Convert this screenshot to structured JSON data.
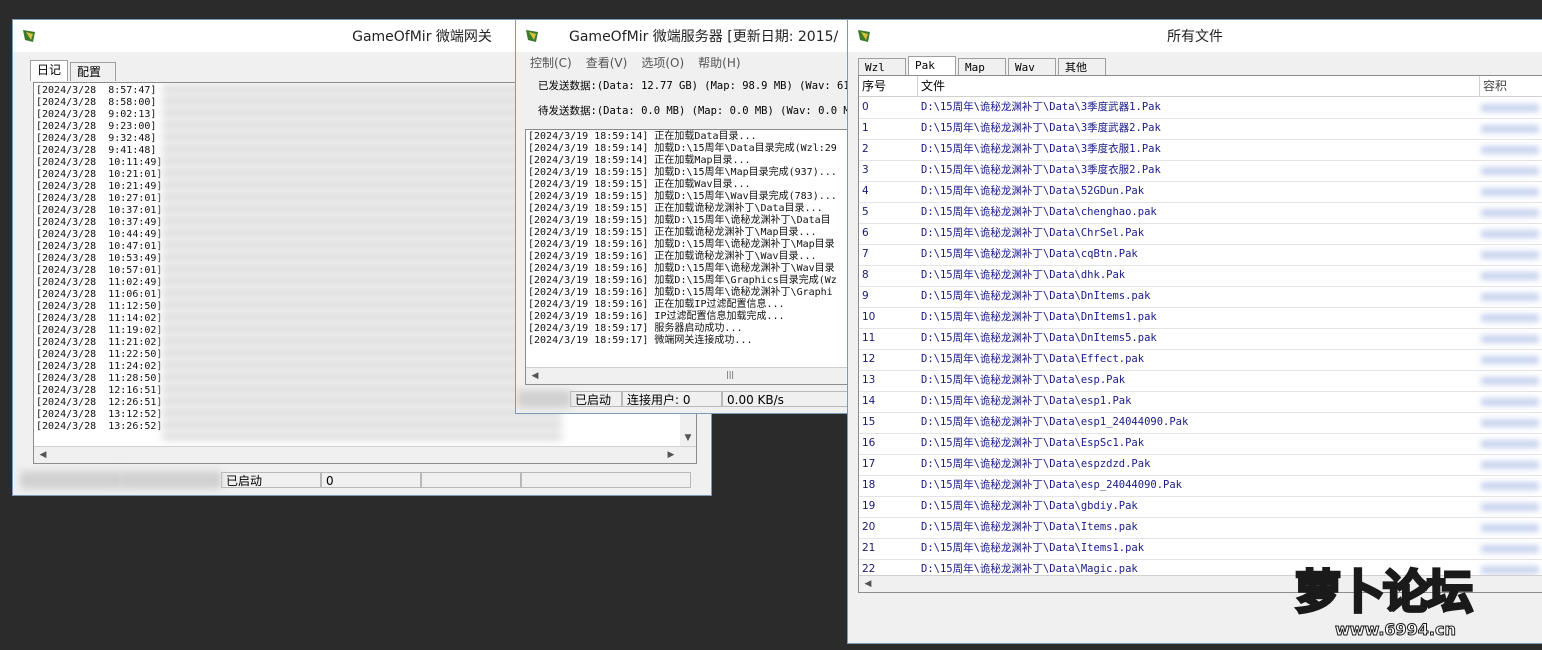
{
  "gateway": {
    "title": "GameOfMir 微端网关",
    "tabs": [
      "日记",
      "配置"
    ],
    "log_times": [
      "[2024/3/28  8:57:47]",
      "[2024/3/28  8:58:00]",
      "[2024/3/28  9:02:13]",
      "[2024/3/28  9:23:00]",
      "[2024/3/28  9:32:48]",
      "[2024/3/28  9:41:48]",
      "[2024/3/28  10:11:49]",
      "[2024/3/28  10:21:01]",
      "[2024/3/28  10:21:49]",
      "[2024/3/28  10:27:01]",
      "[2024/3/28  10:37:01]",
      "[2024/3/28  10:37:49]",
      "[2024/3/28  10:44:49]",
      "[2024/3/28  10:47:01]",
      "[2024/3/28  10:53:49]",
      "[2024/3/28  10:57:01]",
      "[2024/3/28  11:02:49]",
      "[2024/3/28  11:06:01]",
      "[2024/3/28  11:12:50]",
      "[2024/3/28  11:14:02]",
      "[2024/3/28  11:19:02]",
      "[2024/3/28  11:21:02]",
      "[2024/3/28  11:22:50]",
      "[2024/3/28  11:24:02]",
      "[2024/3/28  11:28:50]",
      "[2024/3/28  12:16:51]",
      "[2024/3/28  12:26:51]",
      "[2024/3/28  13:12:52]",
      "[2024/3/28  13:26:52]"
    ],
    "status": {
      "state": "已启动",
      "count": "0"
    }
  },
  "server": {
    "title": "GameOfMir 微端服务器 [更新日期: 2015/",
    "menu": [
      "控制(C)",
      "查看(V)",
      "选项(O)",
      "帮助(H)"
    ],
    "sent": "已发送数据:(Data: 12.77 GB) (Map: 98.9 MB) (Wav: 61",
    "pending": "待发送数据:(Data: 0.0 MB) (Map: 0.0 MB) (Wav: 0.0 M",
    "log": [
      "[2024/3/19 18:59:14] 正在加载Data目录...",
      "[2024/3/19 18:59:14] 加载D:\\15周年\\Data目录完成(Wzl:29",
      "[2024/3/19 18:59:14] 正在加载Map目录...",
      "[2024/3/19 18:59:15] 加载D:\\15周年\\Map目录完成(937)...",
      "[2024/3/19 18:59:15] 正在加载Wav目录...",
      "[2024/3/19 18:59:15] 加载D:\\15周年\\Wav目录完成(783)...",
      "[2024/3/19 18:59:15] 正在加载诡秘龙渊补丁\\Data目录...",
      "[2024/3/19 18:59:15] 加载D:\\15周年\\诡秘龙渊补丁\\Data目",
      "[2024/3/19 18:59:15] 正在加载诡秘龙渊补丁\\Map目录...",
      "[2024/3/19 18:59:16] 加载D:\\15周年\\诡秘龙渊补丁\\Map目录",
      "[2024/3/19 18:59:16] 正在加载诡秘龙渊补丁\\Wav目录...",
      "[2024/3/19 18:59:16] 加载D:\\15周年\\诡秘龙渊补丁\\Wav目录",
      "[2024/3/19 18:59:16] 加载D:\\15周年\\Graphics目录完成(Wz",
      "[2024/3/19 18:59:16] 加载D:\\15周年\\诡秘龙渊补丁\\Graphi",
      "[2024/3/19 18:59:16] 正在加载IP过滤配置信息...",
      "[2024/3/19 18:59:16] IP过滤配置信息加载完成...",
      "[2024/3/19 18:59:17] 服务器启动成功...",
      "[2024/3/19 18:59:17] 微端网关连接成功..."
    ],
    "status": {
      "state": "已启动",
      "users": "连接用户: 0",
      "speed": "0.00 KB/s"
    }
  },
  "files": {
    "title": "所有文件",
    "tabs": [
      "Wzl",
      "Pak",
      "Map",
      "Wav",
      "其他"
    ],
    "columns": {
      "index": "序号",
      "file": "文件",
      "size": "容积"
    },
    "rows": [
      {
        "i": "0",
        "path": "D:\\15周年\\诡秘龙渊补丁\\Data\\3季度武器1.Pak"
      },
      {
        "i": "1",
        "path": "D:\\15周年\\诡秘龙渊补丁\\Data\\3季度武器2.Pak"
      },
      {
        "i": "2",
        "path": "D:\\15周年\\诡秘龙渊补丁\\Data\\3季度衣服1.Pak"
      },
      {
        "i": "3",
        "path": "D:\\15周年\\诡秘龙渊补丁\\Data\\3季度衣服2.Pak"
      },
      {
        "i": "4",
        "path": "D:\\15周年\\诡秘龙渊补丁\\Data\\52GDun.Pak"
      },
      {
        "i": "5",
        "path": "D:\\15周年\\诡秘龙渊补丁\\Data\\chenghao.pak"
      },
      {
        "i": "6",
        "path": "D:\\15周年\\诡秘龙渊补丁\\Data\\ChrSel.Pak"
      },
      {
        "i": "7",
        "path": "D:\\15周年\\诡秘龙渊补丁\\Data\\cqBtn.Pak"
      },
      {
        "i": "8",
        "path": "D:\\15周年\\诡秘龙渊补丁\\Data\\dhk.Pak"
      },
      {
        "i": "9",
        "path": "D:\\15周年\\诡秘龙渊补丁\\Data\\DnItems.pak"
      },
      {
        "i": "10",
        "path": "D:\\15周年\\诡秘龙渊补丁\\Data\\DnItems1.pak"
      },
      {
        "i": "11",
        "path": "D:\\15周年\\诡秘龙渊补丁\\Data\\DnItems5.pak"
      },
      {
        "i": "12",
        "path": "D:\\15周年\\诡秘龙渊补丁\\Data\\Effect.pak"
      },
      {
        "i": "13",
        "path": "D:\\15周年\\诡秘龙渊补丁\\Data\\esp.Pak"
      },
      {
        "i": "14",
        "path": "D:\\15周年\\诡秘龙渊补丁\\Data\\esp1.Pak"
      },
      {
        "i": "15",
        "path": "D:\\15周年\\诡秘龙渊补丁\\Data\\esp1_24044090.Pak"
      },
      {
        "i": "16",
        "path": "D:\\15周年\\诡秘龙渊补丁\\Data\\EspSc1.Pak"
      },
      {
        "i": "17",
        "path": "D:\\15周年\\诡秘龙渊补丁\\Data\\espzdzd.Pak"
      },
      {
        "i": "18",
        "path": "D:\\15周年\\诡秘龙渊补丁\\Data\\esp_24044090.Pak"
      },
      {
        "i": "19",
        "path": "D:\\15周年\\诡秘龙渊补丁\\Data\\gbdiy.Pak"
      },
      {
        "i": "20",
        "path": "D:\\15周年\\诡秘龙渊补丁\\Data\\Items.pak"
      },
      {
        "i": "21",
        "path": "D:\\15周年\\诡秘龙渊补丁\\Data\\Items1.pak"
      },
      {
        "i": "22",
        "path": "D:\\15周年\\诡秘龙渊补丁\\Data\\Magic.pak"
      }
    ]
  },
  "watermark": {
    "logo": "萝卜论坛",
    "url": "www.6994.cn"
  },
  "colors": {
    "path_text": "#1a1a8a",
    "title_bg": "#ffffff",
    "window_bg": "#f0f0f0"
  }
}
